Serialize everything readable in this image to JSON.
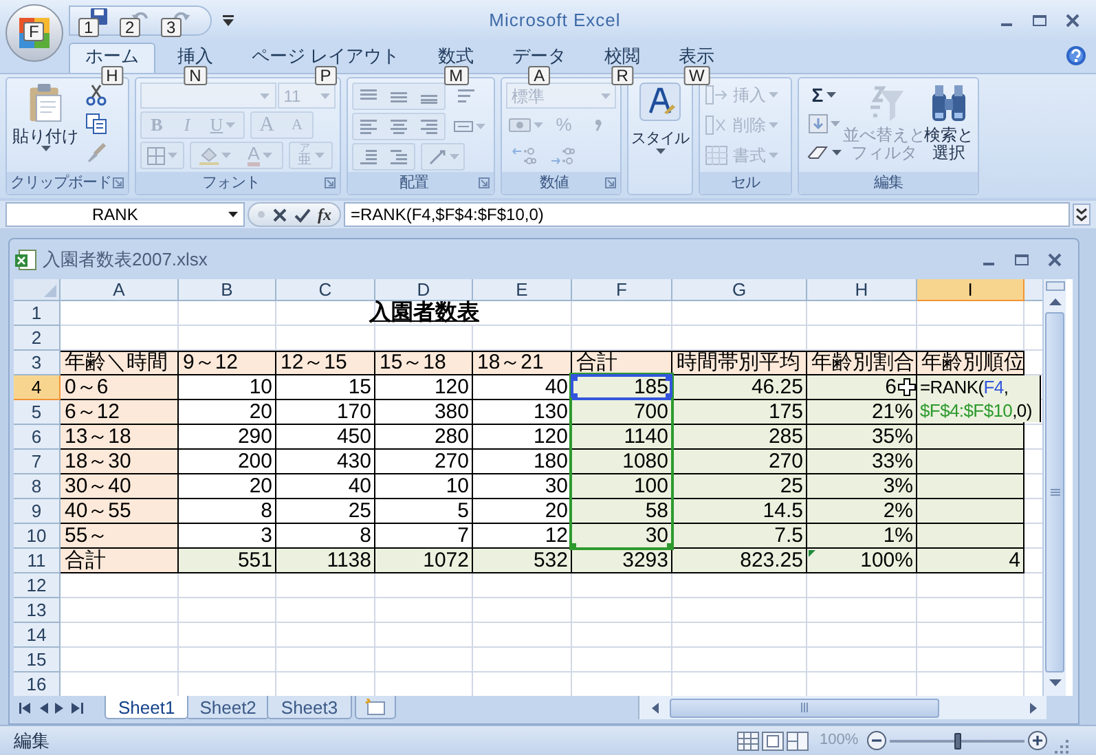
{
  "window": {
    "title": "Microsoft Excel"
  },
  "office_button": {
    "keytip": "F"
  },
  "quick_access": [
    {
      "kind": "save",
      "keytip": "1"
    },
    {
      "kind": "undo",
      "keytip": "2"
    },
    {
      "kind": "redo",
      "keytip": "3"
    }
  ],
  "tabs": [
    {
      "label": "ホーム",
      "keytip": "H",
      "selected": true
    },
    {
      "label": "挿入",
      "keytip": "N",
      "selected": false
    },
    {
      "label": "ページ レイアウト",
      "keytip": "P",
      "selected": false
    },
    {
      "label": "数式",
      "keytip": "M",
      "selected": false
    },
    {
      "label": "データ",
      "keytip": "A",
      "selected": false
    },
    {
      "label": "校閲",
      "keytip": "R",
      "selected": false
    },
    {
      "label": "表示",
      "keytip": "W",
      "selected": false
    }
  ],
  "ribbon": [
    {
      "kind": "clipboard",
      "label": "クリップボード",
      "paste": "貼り付け",
      "disabled": false
    },
    {
      "kind": "font",
      "label": "フォント",
      "size": "11",
      "bold": "B",
      "italic": "I",
      "underline": "U",
      "grow": "A",
      "shrink": "A",
      "font_color": "A",
      "phonetic_ruby": "ア",
      "phonetic": "亜",
      "disabled": true
    },
    {
      "kind": "alignment",
      "label": "配置",
      "disabled": true
    },
    {
      "kind": "number",
      "label": "数値",
      "format": "標準",
      "percent": "%",
      "disabled": true
    },
    {
      "kind": "styles",
      "button": "スタイル",
      "disabled": false
    },
    {
      "kind": "cells",
      "label": "セル",
      "buttons": [
        "挿入",
        "削除",
        "書式"
      ],
      "disabled": true
    },
    {
      "kind": "editing",
      "label": "編集",
      "sum": "Σ",
      "sort": {
        "lines": [
          "並べ替えと",
          "フィルタ"
        ],
        "disabled": true
      },
      "find": {
        "lines": [
          "検索と",
          "選択"
        ],
        "disabled": false
      }
    }
  ],
  "formula_bar": {
    "name_box": "RANK",
    "function_button": "fx",
    "formula": "=RANK(F4,$F$4:$F$10,0)"
  },
  "workbook": {
    "title": "入園者数表2007.xlsx",
    "columns": [
      {
        "label": "A",
        "selected": false
      },
      {
        "label": "B",
        "selected": false
      },
      {
        "label": "C",
        "selected": false
      },
      {
        "label": "D",
        "selected": false
      },
      {
        "label": "E",
        "selected": false
      },
      {
        "label": "F",
        "selected": false
      },
      {
        "label": "G",
        "selected": false
      },
      {
        "label": "H",
        "selected": false
      },
      {
        "label": "I",
        "selected": true
      }
    ],
    "rows": [
      {
        "label": "1",
        "selected": false,
        "cells": [
          {
            "kind": "empty"
          },
          {
            "kind": "empty"
          },
          {
            "kind": "empty"
          },
          {
            "kind": "title",
            "text": "入園者数表"
          }
        ]
      },
      {
        "label": "2",
        "selected": false
      },
      {
        "label": "3",
        "selected": false,
        "cells": [
          {
            "text": "年齢＼時間",
            "kind": "text",
            "color": "#fde9d9"
          },
          {
            "text": "9～12",
            "kind": "text",
            "color": "#fde9d9"
          },
          {
            "text": "12～15",
            "kind": "text",
            "color": "#fde9d9"
          },
          {
            "text": "15～18",
            "kind": "text",
            "color": "#fde9d9"
          },
          {
            "text": "18～21",
            "kind": "text",
            "color": "#fde9d9"
          },
          {
            "text": "合計",
            "kind": "text",
            "color": "#fde9d9"
          },
          {
            "text": "時間帯別平均",
            "kind": "text",
            "color": "#fde9d9"
          },
          {
            "text": "年齢別割合",
            "kind": "text",
            "color": "#fde9d9"
          },
          {
            "text": "年齢別順位",
            "kind": "text",
            "color": "#fde9d9"
          }
        ]
      },
      {
        "label": "4",
        "selected": true,
        "cells": [
          {
            "text": "0～6",
            "kind": "text",
            "color": "#fde9d9"
          },
          {
            "text": "10",
            "kind": "number"
          },
          {
            "text": "15",
            "kind": "number"
          },
          {
            "text": "120",
            "kind": "number"
          },
          {
            "text": "40",
            "kind": "number"
          },
          {
            "text": "185",
            "kind": "number",
            "color": "#ebf1de",
            "ref_cell": true,
            "ref_range": true
          },
          {
            "text": "46.25",
            "kind": "number",
            "color": "#ebf1de"
          },
          {
            "text": "6",
            "kind": "number",
            "color": "#ebf1de",
            "cursor": true
          },
          {
            "kind": "editing",
            "color": "#ebf1de",
            "editor_lines": [
              [
                {
                  "text": "=RANK(",
                  "color": "#000000"
                },
                {
                  "text": "F4",
                  "color": "#3355dd"
                },
                {
                  "text": ",",
                  "color": "#000000"
                }
              ],
              [
                {
                  "text": "$F$4:$F$10",
                  "color": "#2e9a2e"
                },
                {
                  "text": ",0)",
                  "color": "#000000"
                }
              ]
            ]
          }
        ]
      },
      {
        "label": "5",
        "selected": false,
        "cells": [
          {
            "text": "6～12",
            "kind": "text",
            "color": "#fde9d9"
          },
          {
            "text": "20",
            "kind": "number"
          },
          {
            "text": "170",
            "kind": "number"
          },
          {
            "text": "380",
            "kind": "number"
          },
          {
            "text": "130",
            "kind": "number"
          },
          {
            "text": "700",
            "kind": "number",
            "color": "#ebf1de",
            "ref_range": true
          },
          {
            "text": "175",
            "kind": "number",
            "color": "#ebf1de"
          },
          {
            "text": "21%",
            "kind": "number",
            "color": "#ebf1de"
          },
          {
            "kind": "number",
            "color": "#ebf1de"
          }
        ]
      },
      {
        "label": "6",
        "selected": false,
        "cells": [
          {
            "text": "13～18",
            "kind": "text",
            "color": "#fde9d9"
          },
          {
            "text": "290",
            "kind": "number"
          },
          {
            "text": "450",
            "kind": "number"
          },
          {
            "text": "280",
            "kind": "number"
          },
          {
            "text": "120",
            "kind": "number"
          },
          {
            "text": "1140",
            "kind": "number",
            "color": "#ebf1de",
            "ref_range": true
          },
          {
            "text": "285",
            "kind": "number",
            "color": "#ebf1de"
          },
          {
            "text": "35%",
            "kind": "number",
            "color": "#ebf1de"
          },
          {
            "kind": "number",
            "color": "#ebf1de"
          }
        ]
      },
      {
        "label": "7",
        "selected": false,
        "cells": [
          {
            "text": "18～30",
            "kind": "text",
            "color": "#fde9d9"
          },
          {
            "text": "200",
            "kind": "number"
          },
          {
            "text": "430",
            "kind": "number"
          },
          {
            "text": "270",
            "kind": "number"
          },
          {
            "text": "180",
            "kind": "number"
          },
          {
            "text": "1080",
            "kind": "number",
            "color": "#ebf1de",
            "ref_range": true
          },
          {
            "text": "270",
            "kind": "number",
            "color": "#ebf1de"
          },
          {
            "text": "33%",
            "kind": "number",
            "color": "#ebf1de"
          },
          {
            "kind": "number",
            "color": "#ebf1de"
          }
        ]
      },
      {
        "label": "8",
        "selected": false,
        "cells": [
          {
            "text": "30～40",
            "kind": "text",
            "color": "#fde9d9"
          },
          {
            "text": "20",
            "kind": "number"
          },
          {
            "text": "40",
            "kind": "number"
          },
          {
            "text": "10",
            "kind": "number"
          },
          {
            "text": "30",
            "kind": "number"
          },
          {
            "text": "100",
            "kind": "number",
            "color": "#ebf1de",
            "ref_range": true
          },
          {
            "text": "25",
            "kind": "number",
            "color": "#ebf1de"
          },
          {
            "text": "3%",
            "kind": "number",
            "color": "#ebf1de"
          },
          {
            "kind": "number",
            "color": "#ebf1de"
          }
        ]
      },
      {
        "label": "9",
        "selected": false,
        "cells": [
          {
            "text": "40～55",
            "kind": "text",
            "color": "#fde9d9"
          },
          {
            "text": "8",
            "kind": "number"
          },
          {
            "text": "25",
            "kind": "number"
          },
          {
            "text": "5",
            "kind": "number"
          },
          {
            "text": "20",
            "kind": "number"
          },
          {
            "text": "58",
            "kind": "number",
            "color": "#ebf1de",
            "ref_range": true
          },
          {
            "text": "14.5",
            "kind": "number",
            "color": "#ebf1de"
          },
          {
            "text": "2%",
            "kind": "number",
            "color": "#ebf1de"
          },
          {
            "kind": "number",
            "color": "#ebf1de"
          }
        ]
      },
      {
        "label": "10",
        "selected": false,
        "cells": [
          {
            "text": "55～",
            "kind": "text",
            "color": "#fde9d9"
          },
          {
            "text": "3",
            "kind": "number"
          },
          {
            "text": "8",
            "kind": "number"
          },
          {
            "text": "7",
            "kind": "number"
          },
          {
            "text": "12",
            "kind": "number"
          },
          {
            "text": "30",
            "kind": "number",
            "color": "#ebf1de",
            "ref_range": true
          },
          {
            "text": "7.5",
            "kind": "number",
            "color": "#ebf1de"
          },
          {
            "text": "1%",
            "kind": "number",
            "color": "#ebf1de"
          },
          {
            "kind": "number",
            "color": "#ebf1de"
          }
        ]
      },
      {
        "label": "11",
        "selected": false,
        "cells": [
          {
            "text": "合計",
            "kind": "text",
            "color": "#fde9d9"
          },
          {
            "text": "551",
            "kind": "number",
            "color": "#ebf1de"
          },
          {
            "text": "1138",
            "kind": "number",
            "color": "#ebf1de"
          },
          {
            "text": "1072",
            "kind": "number",
            "color": "#ebf1de"
          },
          {
            "text": "532",
            "kind": "number",
            "color": "#ebf1de"
          },
          {
            "text": "3293",
            "kind": "number",
            "color": "#ebf1de"
          },
          {
            "text": "823.25",
            "kind": "number",
            "color": "#ebf1de"
          },
          {
            "text": "100%",
            "kind": "number",
            "color": "#ebf1de",
            "flagged": true
          },
          {
            "text": "4",
            "kind": "number",
            "color": "#ebf1de"
          }
        ]
      },
      {
        "label": "12",
        "selected": false
      },
      {
        "label": "13",
        "selected": false
      },
      {
        "label": "14",
        "selected": false
      },
      {
        "label": "15",
        "selected": false
      },
      {
        "label": "16",
        "selected": false
      }
    ],
    "sheets": [
      {
        "label": "Sheet1",
        "selected": true
      },
      {
        "label": "Sheet2",
        "selected": false
      },
      {
        "label": "Sheet3",
        "selected": false
      }
    ]
  },
  "status_bar": {
    "mode": "編集",
    "zoom": "100%",
    "zoom_slider": {
      "level": 0.5
    }
  }
}
